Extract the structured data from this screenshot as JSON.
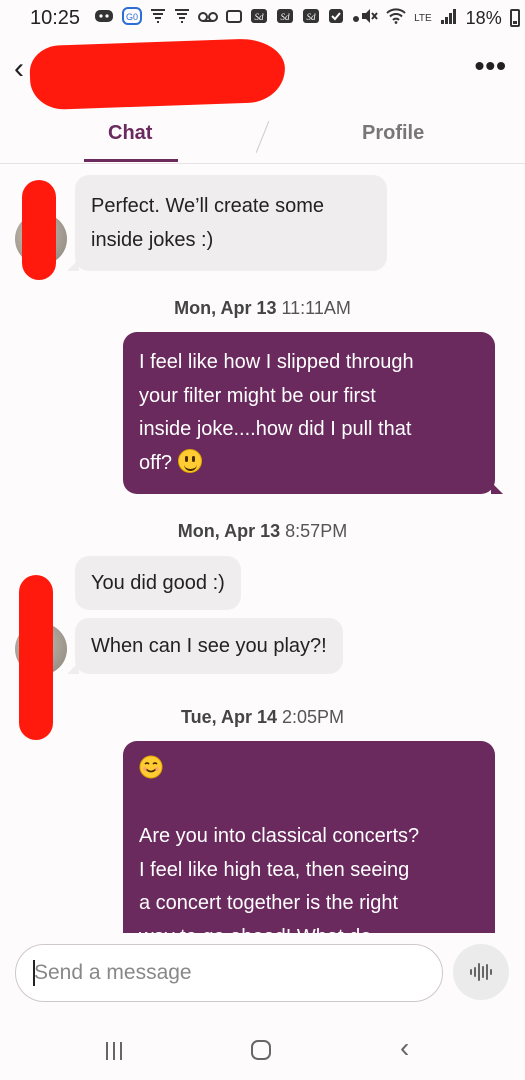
{
  "status_bar": {
    "time": "10:25",
    "network": "LTE",
    "battery": "18%"
  },
  "header": {
    "back_icon": "back-arrow-icon",
    "more_icon": "more-options-icon"
  },
  "tabs": [
    {
      "label": "Chat",
      "active": true
    },
    {
      "label": "Profile",
      "active": false
    }
  ],
  "messages": {
    "m1": {
      "line1": "Perfect. We’ll create some",
      "line2": "inside jokes :)"
    },
    "t1": {
      "day": "Mon, Apr 13",
      "time": "11:11AM"
    },
    "m2": {
      "line1": "I feel like how I slipped through",
      "line2": "your filter might be our first",
      "line3": "inside joke....how did I pull that",
      "line4": "off?"
    },
    "t2": {
      "day": "Mon, Apr 13",
      "time": "8:57PM"
    },
    "m3": {
      "text": "You did good :)"
    },
    "m4": {
      "text": "When can I see you play?!"
    },
    "t3": {
      "day": "Tue, Apr 14",
      "time": "2:05PM"
    },
    "m5": {
      "line1": "Are you into classical concerts?",
      "line2": "I feel like high tea, then seeing",
      "line3": "a concert together is the right",
      "line4": "way to go ahead! What do"
    }
  },
  "composer": {
    "placeholder": "Send a message",
    "voice_icon": "voice-waveform-icon"
  },
  "colors": {
    "accent": "#6a2a5e",
    "incoming_bubble": "#efedee",
    "redaction": "#ff1a0d"
  }
}
